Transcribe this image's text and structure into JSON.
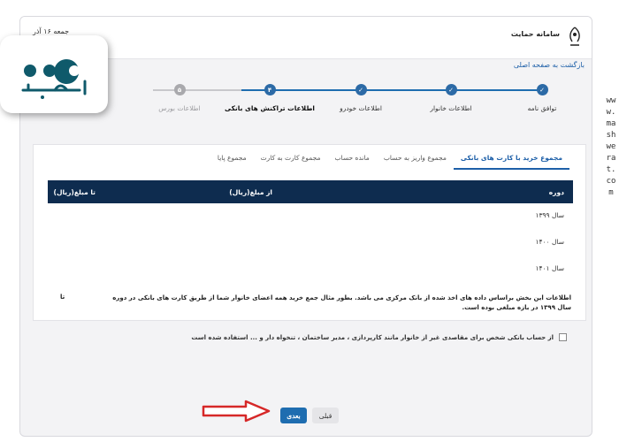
{
  "header": {
    "brand_title": "سامانه حمایت",
    "date_text": "جمعه ۱۶ آذر"
  },
  "back_link": "بازگشت به صفحه اصلی",
  "stepper": {
    "steps": [
      {
        "num": "✓",
        "label": "توافق نامه",
        "state": "done"
      },
      {
        "num": "✓",
        "label": "اطلاعات خانوار",
        "state": "done"
      },
      {
        "num": "✓",
        "label": "اطلاعات خودرو",
        "state": "done"
      },
      {
        "num": "۴",
        "label": "اطلاعات تراکنش های بانکی",
        "state": "active"
      },
      {
        "num": "۵",
        "label": "اطلاعات بورس",
        "state": "inactive"
      }
    ]
  },
  "tabs": [
    {
      "label": "مجموع خرید با کارت های بانکی",
      "active": true
    },
    {
      "label": "مجموع واریز به حساب",
      "active": false
    },
    {
      "label": "مانده حساب",
      "active": false
    },
    {
      "label": "مجموع کارت به کارت",
      "active": false
    },
    {
      "label": "مجموع پایا",
      "active": false
    }
  ],
  "table": {
    "columns": {
      "period": "دوره",
      "from": "از مبلغ(ریال)",
      "to": "تا مبلغ(ریال)"
    },
    "rows": [
      {
        "period": "سال ۱۳۹۹"
      },
      {
        "period": "سال ۱۴۰۰"
      },
      {
        "period": "سال ۱۴۰۱"
      }
    ]
  },
  "info": {
    "text": "اطلاعات این بخش براساس داده های اخذ شده از بانک مرکزی می باشد. بطور مثال جمع خرید همه اعضای خانوار شما از طریق کارت های بانکی در دوره سال ۱۳۹۹ در بازه مبلغی بوده است.",
    "to_word": "تا"
  },
  "checkbox": {
    "label": "از حساب بانکی شخص برای مقاصدی غیر از خانوار مانند کارپردازی ، مدیر ساختمان ، تنخواه دار و ... استفاده شده است",
    "checked": false
  },
  "buttons": {
    "next": "بعدی",
    "prev": "قبلی"
  },
  "watermark": "www.mashwerat.com",
  "colors": {
    "primary": "#1e6db0",
    "table_header": "#0e2c4f",
    "arrow": "#d62828",
    "logo": "#0f5a6b"
  }
}
